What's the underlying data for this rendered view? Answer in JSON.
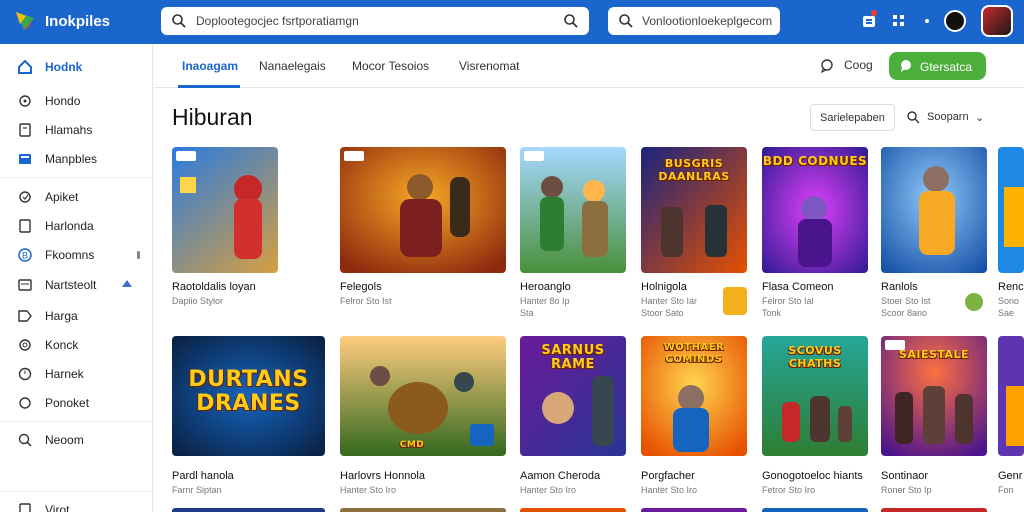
{
  "topbar": {
    "brand": "Inokpiles",
    "search_placeholder": "Doplootegocjec fsrtporatiamgn",
    "search2_placeholder": "Vonlootionloekeplgecom"
  },
  "sidebar": {
    "items": [
      {
        "label": "Hodnk",
        "icon": "home-icon",
        "active": true
      },
      {
        "label": "Hondo",
        "icon": "settings-icon"
      },
      {
        "label": "Hlamahs",
        "icon": "bookmark-icon"
      },
      {
        "label": "Manpbles",
        "icon": "grid-icon"
      },
      {
        "label": "Apiket",
        "icon": "settings-icon"
      },
      {
        "label": "Harlonda",
        "icon": "bookmark-icon"
      },
      {
        "label": "Fkoomns",
        "icon": "coin-icon"
      },
      {
        "label": "Nartsteolt",
        "icon": "list-icon"
      },
      {
        "label": "Harga",
        "icon": "tag-icon"
      },
      {
        "label": "Konck",
        "icon": "settings-icon"
      },
      {
        "label": "Harnek",
        "icon": "clock-icon"
      },
      {
        "label": "Ponoket",
        "icon": "settings-icon"
      },
      {
        "label": "Neoom",
        "icon": "search-icon"
      },
      {
        "label": "Virot",
        "icon": "bookmark-icon"
      }
    ]
  },
  "tabs": [
    {
      "label": "Inaoagam",
      "active": true
    },
    {
      "label": "Nanaelegais"
    },
    {
      "label": "Mocor  Tesoios"
    },
    {
      "label": "Visrenomat"
    }
  ],
  "header_actions": {
    "cog_label": "Coog",
    "green_button": "Gtersatca"
  },
  "main": {
    "title": "Hiburan",
    "filter_label": "Sarielepaben",
    "sort_label": "Sooparn"
  },
  "row1": [
    {
      "title": "Raotoldalis loyan",
      "sub": "Dapiio Stylor",
      "sub2": ""
    },
    {
      "title": "Felegols",
      "sub": "Felror Sto Ist",
      "sub2": ""
    },
    {
      "title": "Heroanglo",
      "sub": "Hanter 8o Ip",
      "sub2": "Sta"
    },
    {
      "title": "Holnigola",
      "sub": "Hanter Sto Iar",
      "sub2": "Stoor Sato"
    },
    {
      "title": "Flasa Comeon",
      "sub": "Felror Sto Ial",
      "sub2": "Tonk"
    },
    {
      "title": "Ranlols",
      "sub": "Stoer Sto Ist",
      "sub2": "Scoor 8ano"
    },
    {
      "title": "Renc",
      "sub": "Sono",
      "sub2": "Sae"
    }
  ],
  "row2": [
    {
      "title": "Pardl hanola",
      "sub": "Farnr Siptan",
      "thumb_text": "DURTANS DRANES"
    },
    {
      "title": "Harlovrs Honnola",
      "sub": "Hanter Sto Iro",
      "thumb_text": "CMD"
    },
    {
      "title": "Aamon Cheroda",
      "sub": "Hanter Sto Iro",
      "thumb_text": "SARNUS RAME"
    },
    {
      "title": "Porgfacher",
      "sub": "Hanter Sto Iro",
      "thumb_text": "WOTHAER COMINDS"
    },
    {
      "title": "Gonogotoeloc hiants",
      "sub": "Fetror Sto Iro",
      "thumb_text": "SCOVUS CHATHS"
    },
    {
      "title": "Sontinaor",
      "sub": "Roner Sto Ip",
      "thumb_text": "SAIESTALE"
    },
    {
      "title": "Genr",
      "sub": "Fon",
      "thumb_text": ""
    }
  ],
  "row1_thumb_texts": [
    "",
    "",
    "",
    "BUSGRIS DAANLRAS",
    "BDD CODNUES",
    "",
    ""
  ]
}
